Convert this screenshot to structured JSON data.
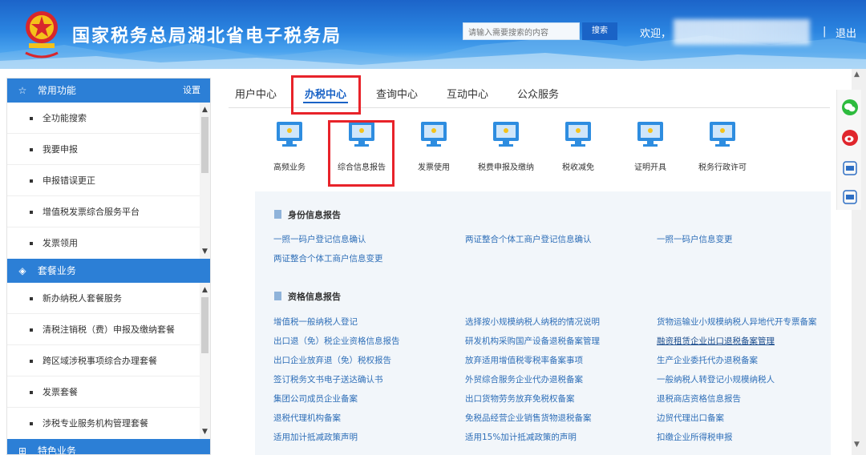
{
  "header": {
    "site_title": "国家税务总局湖北省电子税务局",
    "search_placeholder": "请输入需要搜索的内容",
    "search_button": "搜索",
    "welcome": "欢迎，",
    "separator": "|",
    "logout": "退出"
  },
  "sidebar": {
    "sections": [
      {
        "title": "常用功能",
        "icon": "star-icon",
        "settings": "设置",
        "items": [
          "全功能搜索",
          "我要申报",
          "申报错误更正",
          "增值税发票综合服务平台",
          "发票领用"
        ]
      },
      {
        "title": "套餐业务",
        "icon": "layers-icon",
        "items": [
          "新办纳税人套餐服务",
          "清税注销税（费）申报及缴纳套餐",
          "跨区域涉税事项综合办理套餐",
          "发票套餐",
          "涉税专业服务机构管理套餐"
        ]
      },
      {
        "title": "特色业务",
        "icon": "grid-icon"
      }
    ]
  },
  "tabs": [
    "用户中心",
    "办税中心",
    "查询中心",
    "互动中心",
    "公众服务"
  ],
  "active_tab": "办税中心",
  "categories": [
    "高频业务",
    "综合信息报告",
    "发票使用",
    "税费申报及缴纳",
    "税收减免",
    "证明开具",
    "税务行政许可"
  ],
  "panel": {
    "sections": [
      {
        "title": "身份信息报告",
        "links": [
          "一照一码户登记信息确认",
          "两证整合个体工商户登记信息确认",
          "一照一码户信息变更",
          "两证整合个体工商户信息变更"
        ]
      },
      {
        "title": "资格信息报告",
        "links": [
          "增值税一般纳税人登记",
          "选择按小规模纳税人纳税的情况说明",
          "货物运输业小规模纳税人异地代开专票备案",
          "出口退（免）税企业资格信息报告",
          "研发机构采购国产设备退税备案管理",
          "融资租赁企业出口退税备案管理",
          "出口企业放弃退（免）税权报告",
          "放弃适用增值税零税率备案事项",
          "生产企业委托代办退税备案",
          "签订税务文书电子送达确认书",
          "外贸综合服务企业代办退税备案",
          "一般纳税人转登记小规模纳税人",
          "集团公司成员企业备案",
          "出口货物劳务放弃免税权备案",
          "退税商店资格信息报告",
          "退税代理机构备案",
          "免税品经营企业销售货物退税备案",
          "边贸代理出口备案",
          "适用加计抵减政策声明",
          "适用15%加计抵减政策的声明",
          "扣缴企业所得税申报"
        ]
      }
    ]
  },
  "colors": {
    "primary": "#1a63c6",
    "sidebar_header": "#2c7fd6",
    "highlight_box": "#e8232a",
    "link": "#2f6fb8",
    "panel_bg": "#f2f6fa"
  }
}
